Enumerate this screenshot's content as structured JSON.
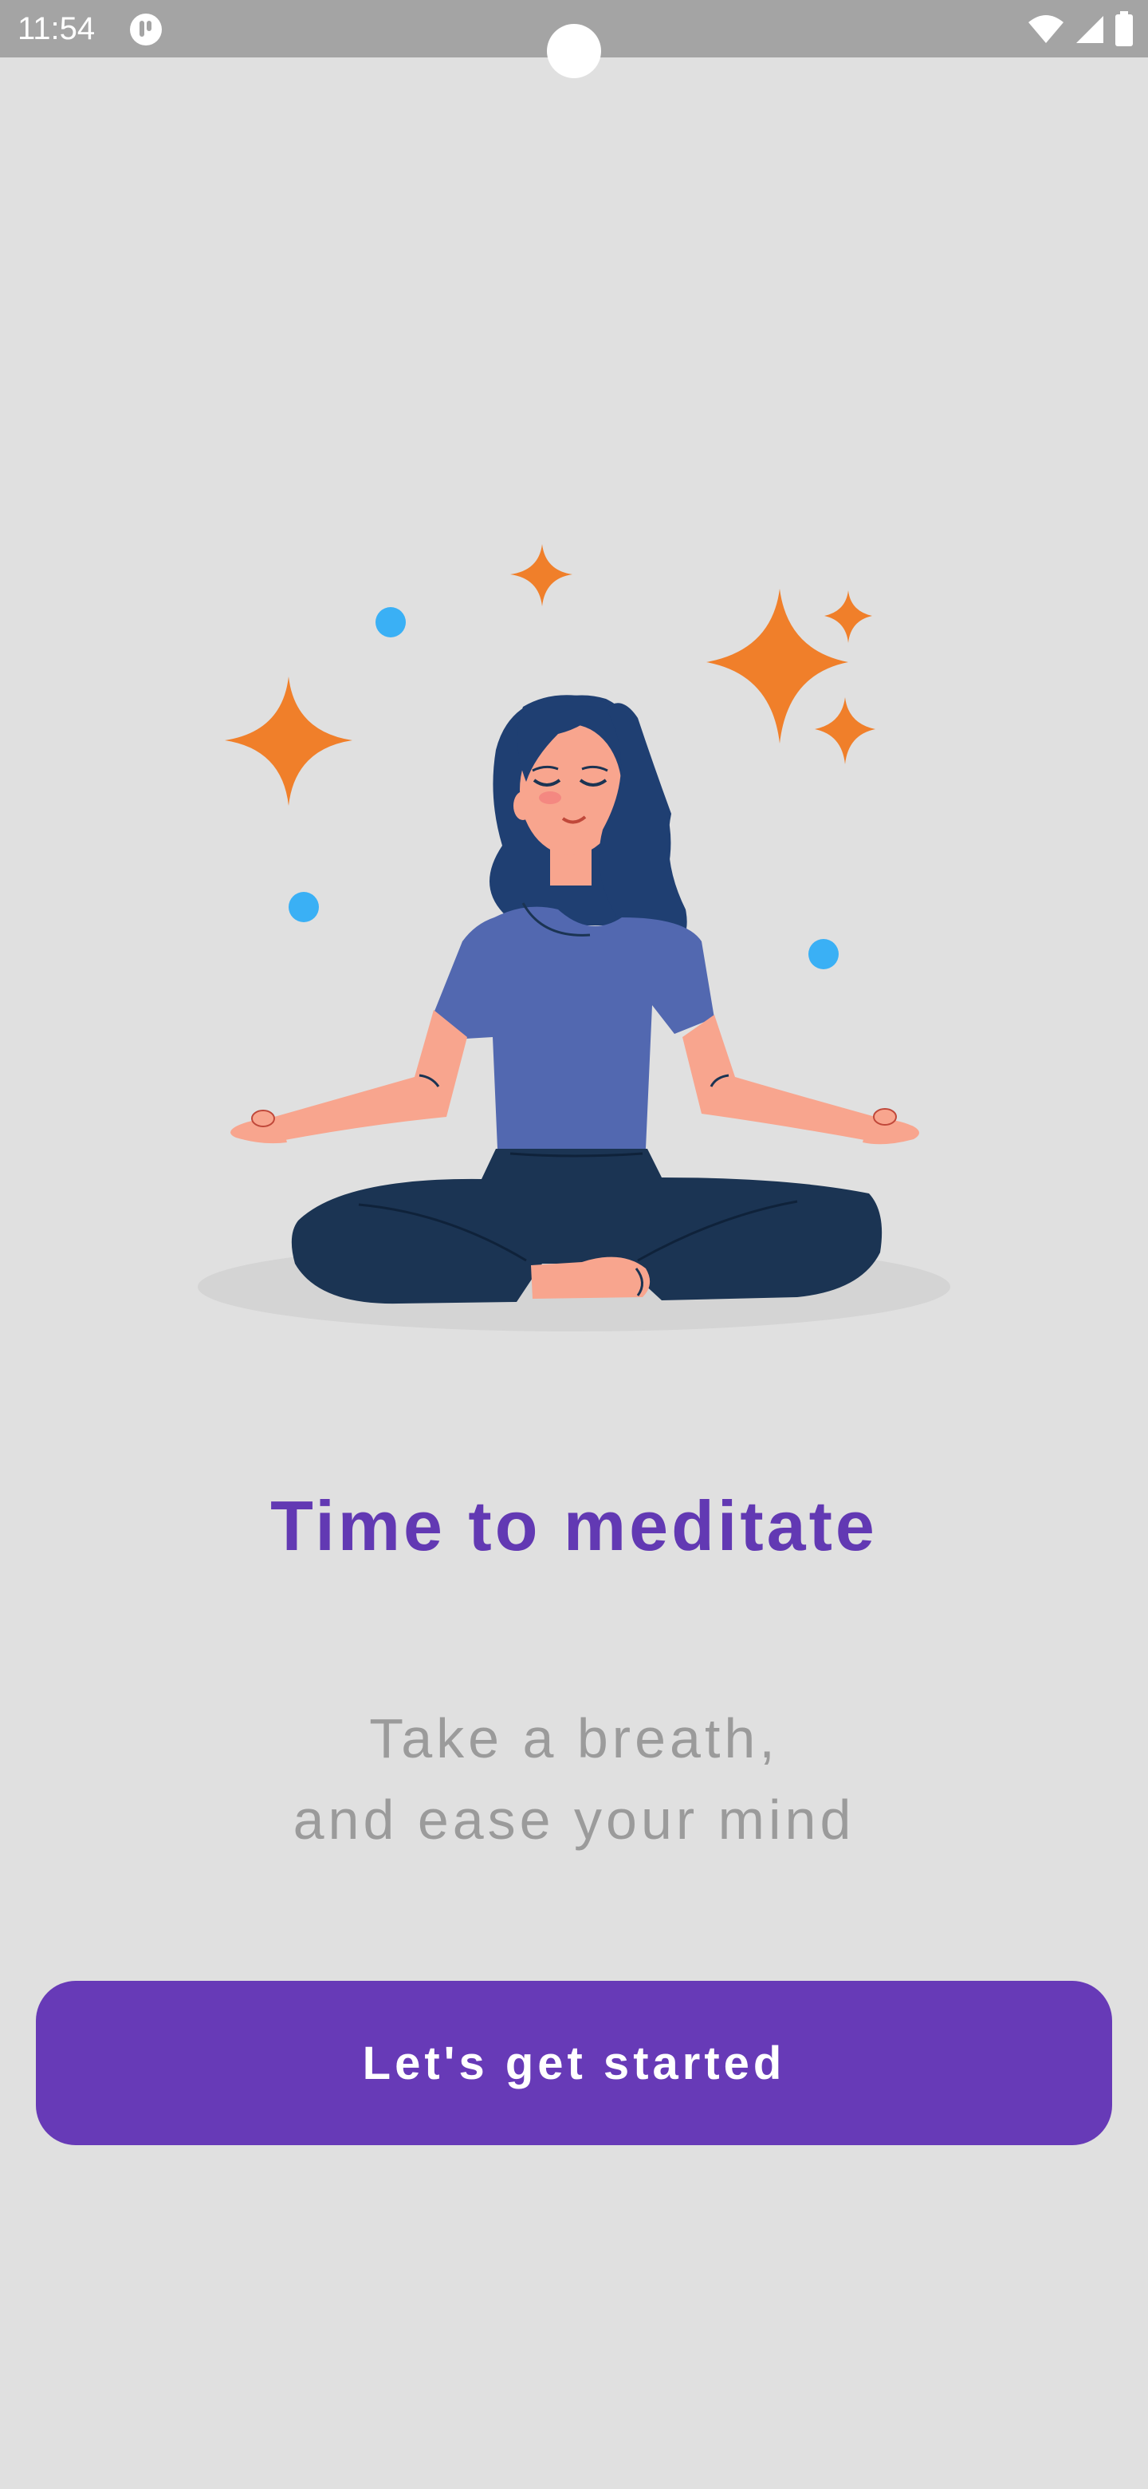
{
  "status_bar": {
    "time": "11:54",
    "icons": [
      "app-notification-icon",
      "wifi-icon",
      "cell-signal-icon",
      "battery-icon"
    ]
  },
  "illustration": {
    "description_icon": "meditating-woman-illustration",
    "colors": {
      "sparkle": "#f07f2a",
      "dot": "#3ab0f5",
      "shirt": "#5268b0",
      "hair": "#1f3f72",
      "pants": "#1b3453",
      "skin": "#f8a58e"
    }
  },
  "onboarding": {
    "title": "Time to meditate",
    "subtitle_line1": "Take a breath,",
    "subtitle_line2": "and ease your mind",
    "cta_label": "Let's get started"
  },
  "colors": {
    "background": "#e0e0e0",
    "accent": "#673ab7",
    "title": "#6239b3",
    "subtitle": "#9b9b9b"
  }
}
